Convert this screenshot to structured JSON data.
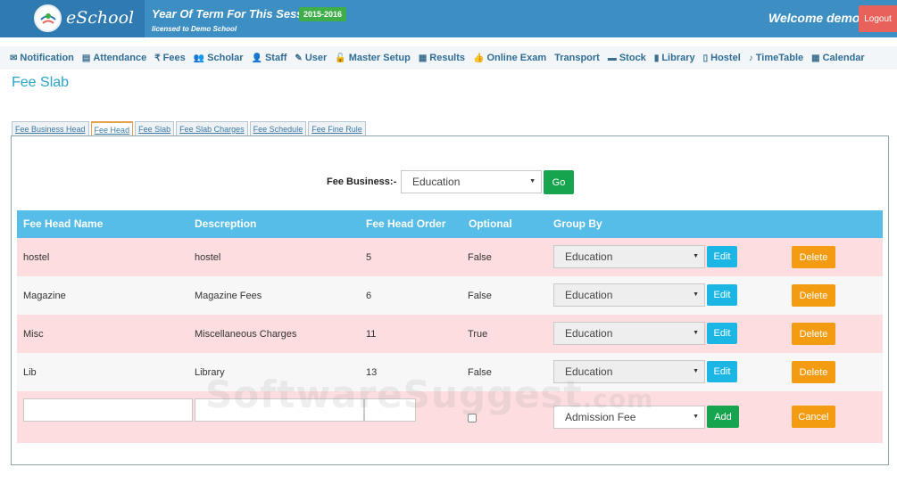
{
  "app": {
    "logo_text": "eSchool",
    "session_title": "Year Of Term For This Session :-",
    "session_badge": "2015-2016",
    "licensed": "licensed to Demo School",
    "welcome": "Welcome demo !",
    "logout": "Logout"
  },
  "nav": {
    "items": [
      {
        "icon": "megaphone-icon",
        "glyph": "✉",
        "label": "Notification"
      },
      {
        "icon": "file-icon",
        "glyph": "▤",
        "label": "Attendance"
      },
      {
        "icon": "rupee-icon",
        "glyph": "₹",
        "label": "Fees"
      },
      {
        "icon": "users-icon",
        "glyph": "👥",
        "label": "Scholar"
      },
      {
        "icon": "user-icon",
        "glyph": "👤",
        "label": "Staff"
      },
      {
        "icon": "wrench-icon",
        "glyph": "✎",
        "label": "User"
      },
      {
        "icon": "unlock-icon",
        "glyph": "🔓",
        "label": "Master Setup"
      },
      {
        "icon": "chart-icon",
        "glyph": "▦",
        "label": "Results"
      },
      {
        "icon": "thumbs-up-icon",
        "glyph": "👍",
        "label": "Online Exam"
      },
      {
        "icon": "",
        "glyph": "",
        "label": "Transport"
      },
      {
        "icon": "folder-icon",
        "glyph": "▬",
        "label": "Stock"
      },
      {
        "icon": "book-icon",
        "glyph": "▮",
        "label": "Library"
      },
      {
        "icon": "building-icon",
        "glyph": "▯",
        "label": "Hostel"
      },
      {
        "icon": "bell-icon",
        "glyph": "♪",
        "label": "TimeTable"
      },
      {
        "icon": "calendar-icon",
        "glyph": "▦",
        "label": "Calendar"
      }
    ]
  },
  "page": {
    "title": "Fee Slab",
    "tabs": [
      "Fee Business Head",
      "Fee Head",
      "Fee Slab",
      "Fee Slab Charges",
      "Fee Schedule",
      "Fee Fine Rule"
    ],
    "active_tab": "Fee Head"
  },
  "filter": {
    "label": "Fee Business:-",
    "selected": "Education",
    "go_label": "Go"
  },
  "table": {
    "headers": [
      "Fee Head Name",
      "Descreption",
      "Fee Head Order",
      "Optional",
      "Group By"
    ],
    "rows": [
      {
        "name": "hostel",
        "description": "hostel",
        "order": "5",
        "optional": "False",
        "group": "Education"
      },
      {
        "name": "Magazine",
        "description": "Magazine Fees",
        "order": "6",
        "optional": "False",
        "group": "Education"
      },
      {
        "name": "Misc",
        "description": "Miscellaneous Charges",
        "order": "11",
        "optional": "True",
        "group": "Education"
      },
      {
        "name": "Lib",
        "description": "Library",
        "order": "13",
        "optional": "False",
        "group": "Education"
      }
    ],
    "edit_label": "Edit",
    "delete_label": "Delete",
    "new_row": {
      "group": "Admission Fee",
      "add_label": "Add",
      "cancel_label": "Cancel"
    }
  },
  "watermark": {
    "main": "SoftwareSuggest",
    "suffix": ".com"
  },
  "colors": {
    "header": "#3d8ec3",
    "table_header": "#56bce8",
    "pink_row": "#fddde0",
    "go_add": "#16a44e",
    "edit": "#1cb6e4",
    "delete": "#f39c12",
    "logout": "#e8615a"
  }
}
